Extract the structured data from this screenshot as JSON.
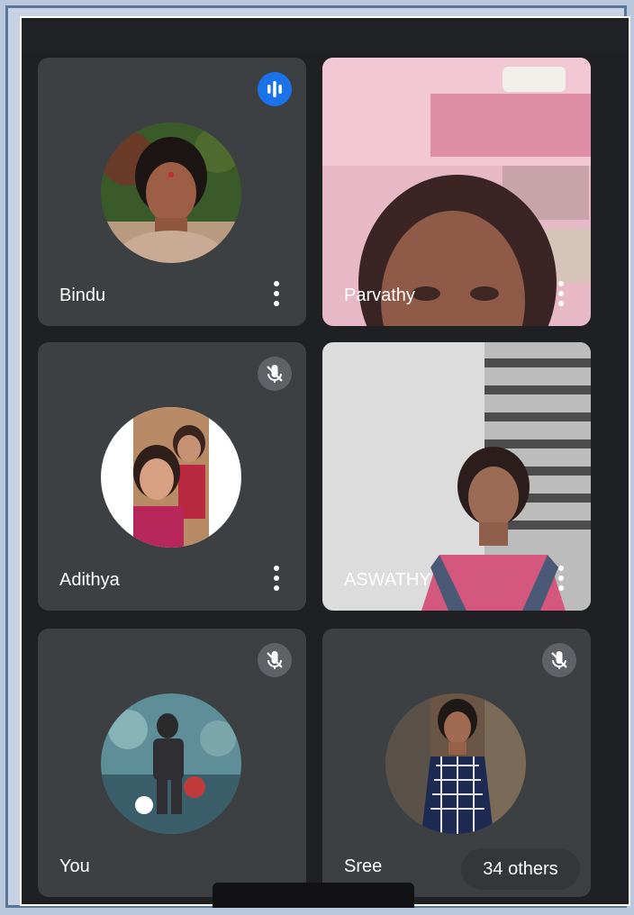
{
  "participants": [
    {
      "name": "Bindu",
      "state": "speaking",
      "view": "avatar"
    },
    {
      "name": "Parvathy",
      "state": "video",
      "view": "video"
    },
    {
      "name": "Adithya",
      "state": "muted",
      "view": "avatar"
    },
    {
      "name": "ASWATHY",
      "state": "video",
      "view": "video"
    },
    {
      "name": "You",
      "state": "muted",
      "view": "avatar"
    },
    {
      "name": "Sree",
      "state": "muted",
      "view": "avatar"
    }
  ],
  "others_label": "34 others",
  "icons": {
    "speaking": "speaking-indicator-icon",
    "muted": "mic-off-icon",
    "menu": "more-vert-icon"
  },
  "colors": {
    "tile_bg": "#3c4043",
    "speaking_accent": "#1a73e8",
    "muted_badge": "#5f6368",
    "frame_border": "#5c7698"
  }
}
